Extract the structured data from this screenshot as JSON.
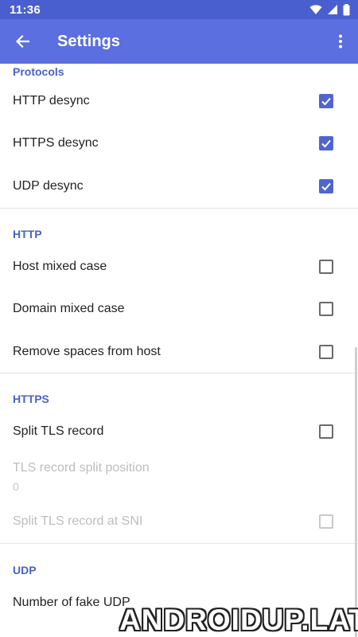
{
  "status_bar": {
    "time": "11:36"
  },
  "app_bar": {
    "title": "Settings"
  },
  "sections": {
    "protocols": {
      "header": "Protocols",
      "items": [
        {
          "label": "HTTP desync",
          "checked": true
        },
        {
          "label": "HTTPS desync",
          "checked": true
        },
        {
          "label": "UDP desync",
          "checked": true
        }
      ]
    },
    "http": {
      "header": "HTTP",
      "items": [
        {
          "label": "Host mixed case",
          "checked": false
        },
        {
          "label": "Domain mixed case",
          "checked": false
        },
        {
          "label": "Remove spaces from host",
          "checked": false
        }
      ]
    },
    "https": {
      "header": "HTTPS",
      "split_tls": {
        "label": "Split TLS record",
        "checked": false
      },
      "split_position": {
        "label": "TLS record split position",
        "summary": "0"
      },
      "split_at_sni": {
        "label": "Split TLS record at SNI",
        "checked": false
      }
    },
    "udp": {
      "header": "UDP",
      "fake_udp": {
        "label": "Number of fake UDP"
      }
    }
  },
  "watermark": "ANDROIDUP.LAT",
  "colors": {
    "status_bar": "#4a5fcf",
    "app_bar": "#5b6fe0",
    "accent": "#4f66cf",
    "section_header": "#4a62c9"
  },
  "icons": {
    "back": "arrow-back-icon",
    "menu": "more-vert-icon",
    "wifi": "wifi-icon",
    "signal": "signal-icon",
    "battery": "battery-icon"
  }
}
